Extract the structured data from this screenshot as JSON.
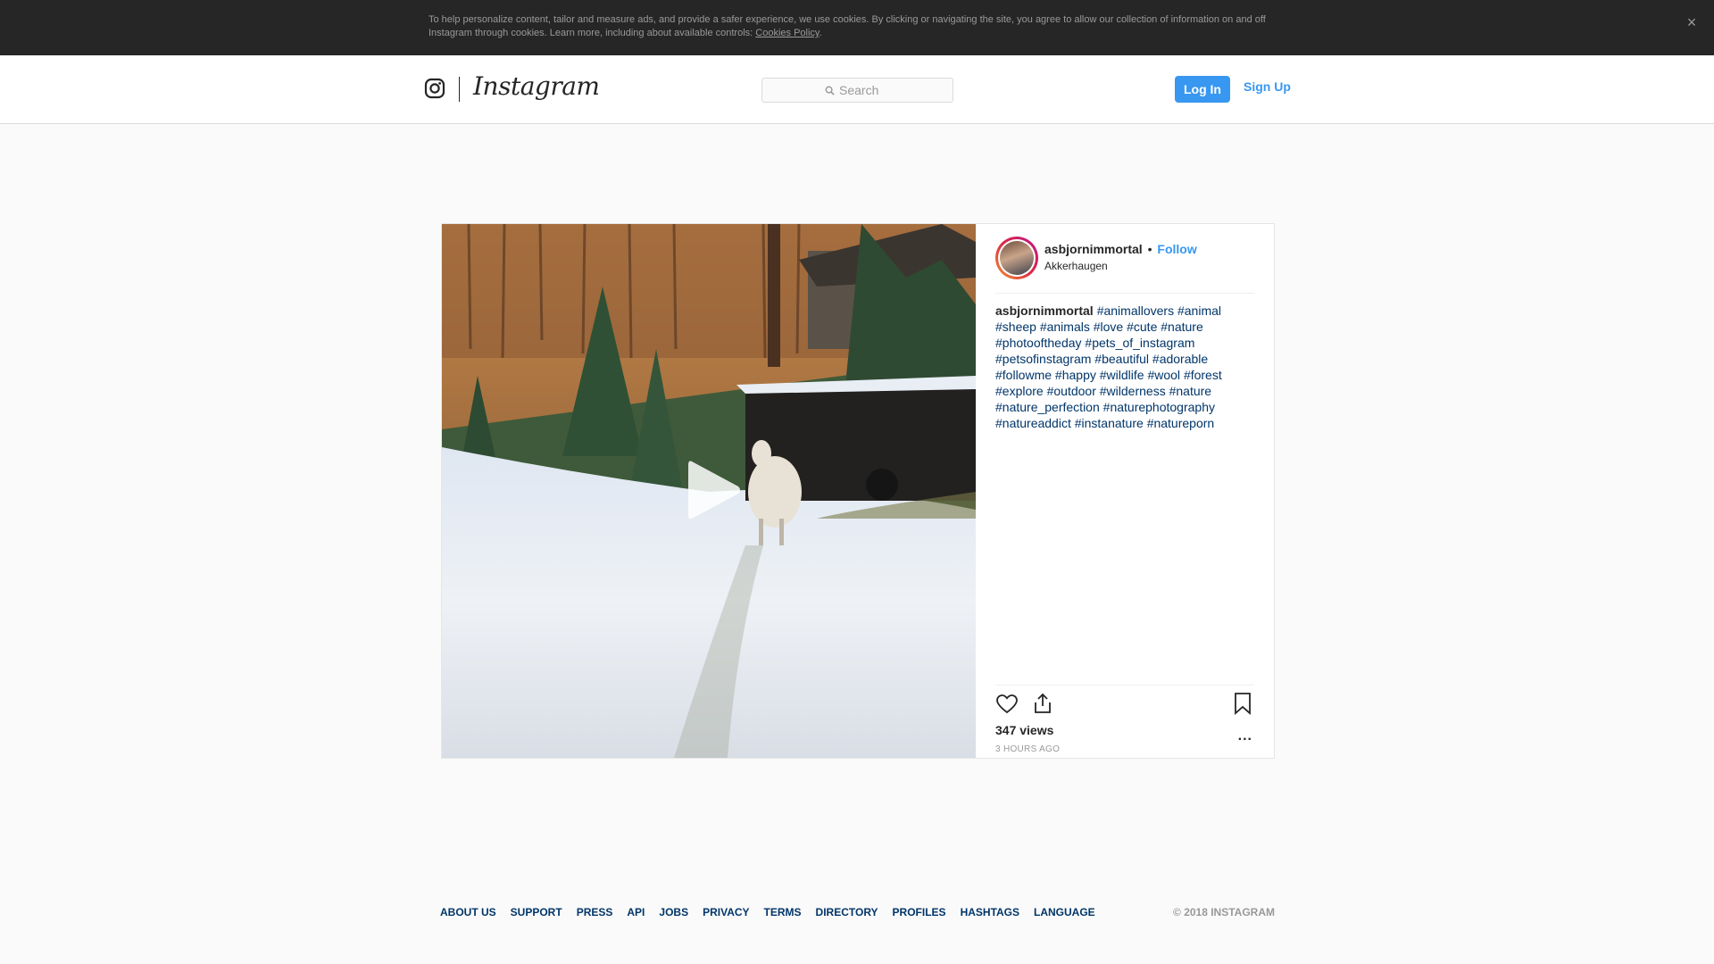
{
  "cookie_banner": {
    "text": "To help personalize content, tailor and measure ads, and provide a safer experience, we use cookies. By clicking or navigating the site, you agree to allow our collection of information on and off Instagram through cookies. Learn more, including about available controls:",
    "link": "Cookies Policy",
    "link_suffix": ".",
    "close_icon": "×"
  },
  "header": {
    "logo_icon": "instagram-glyph-icon",
    "wordmark": "Instagram",
    "search_placeholder": "Search",
    "login_label": "Log In",
    "signup_label": "Sign Up",
    "accent_color": "#3897f0"
  },
  "post": {
    "username": "asbjornimmortal",
    "separator": "•",
    "follow_label": "Follow",
    "location": "Akkerhaugen",
    "caption_user": "asbjornimmortal",
    "hashtags": [
      "#animallovers",
      "#animal",
      "#sheep",
      "#animals",
      "#love",
      "#cute",
      "#nature",
      "#photooftheday",
      "#pets_of_instagram",
      "#petsofinstagram",
      "#beautiful",
      "#adorable",
      "#followme",
      "#happy",
      "#wildlife",
      "#wool",
      "#forest",
      "#explore",
      "#outdoor",
      "#wilderness",
      "#nature",
      "#nature_perfection",
      "#naturephotography",
      "#natureaddict",
      "#instanature",
      "#natureporn"
    ],
    "views": "347 views",
    "timestamp": "3 HOURS AGO",
    "more_label": "...",
    "icons": [
      "heart-icon",
      "share-icon",
      "bookmark-icon",
      "play-icon"
    ]
  },
  "footer": {
    "links": [
      "ABOUT US",
      "SUPPORT",
      "PRESS",
      "API",
      "JOBS",
      "PRIVACY",
      "TERMS",
      "DIRECTORY",
      "PROFILES",
      "HASHTAGS",
      "LANGUAGE"
    ],
    "copyright": "© 2018 INSTAGRAM"
  }
}
